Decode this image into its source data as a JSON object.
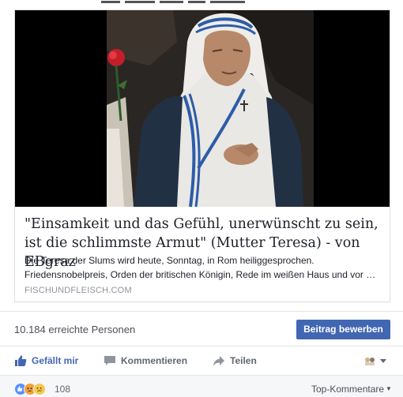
{
  "link_preview": {
    "image_alt": "Mutter Teresa",
    "title": "\"Einsamkeit und das Gefühl, unerwünscht zu sein, ist die schlimmste Armut\" (Mutter Teresa) - von EBgraz",
    "description_line1": "Die Teresa der Slums wird heute, Sonntag, in Rom heiliggesprochen.",
    "description_line2": "Friedensnobelpreis, Orden der britischen Königin, Rede im weißen Haus und vor …",
    "domain": "FISCHUNDFLEISCH.COM"
  },
  "stats": {
    "reach": "10.184 erreichte Personen",
    "boost_label": "Beitrag bewerben"
  },
  "actions": {
    "like": "Gefällt mir",
    "comment": "Kommentieren",
    "share": "Teilen"
  },
  "reactions": {
    "count": "108",
    "sort_label": "Top-Kommentare",
    "icons": [
      "like-reaction-icon",
      "angry-reaction-icon",
      "sad-reaction-icon"
    ]
  },
  "colors": {
    "brand_blue": "#4267b2",
    "like_blue": "#5890ff",
    "muted_text": "#90949c"
  }
}
